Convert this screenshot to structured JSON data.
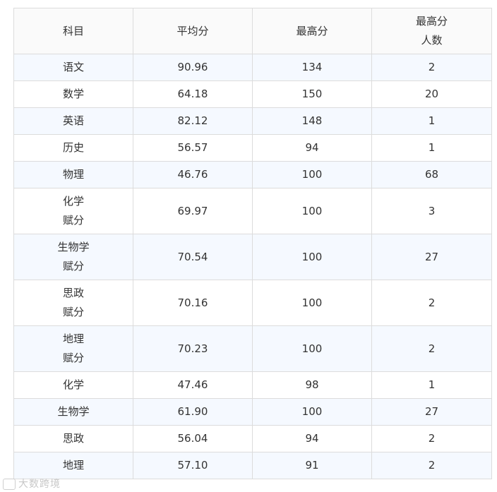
{
  "table": {
    "headers": [
      "科目",
      "平均分",
      "最高分",
      [
        "最高分",
        "人数"
      ]
    ],
    "rows": [
      {
        "subject": [
          "语文"
        ],
        "avg": "90.96",
        "max": "134",
        "count": "2"
      },
      {
        "subject": [
          "数学"
        ],
        "avg": "64.18",
        "max": "150",
        "count": "20"
      },
      {
        "subject": [
          "英语"
        ],
        "avg": "82.12",
        "max": "148",
        "count": "1"
      },
      {
        "subject": [
          "历史"
        ],
        "avg": "56.57",
        "max": "94",
        "count": "1"
      },
      {
        "subject": [
          "物理"
        ],
        "avg": "46.76",
        "max": "100",
        "count": "68"
      },
      {
        "subject": [
          "化学",
          "赋分"
        ],
        "avg": "69.97",
        "max": "100",
        "count": "3"
      },
      {
        "subject": [
          "生物学",
          "赋分"
        ],
        "avg": "70.54",
        "max": "100",
        "count": "27"
      },
      {
        "subject": [
          "思政",
          "赋分"
        ],
        "avg": "70.16",
        "max": "100",
        "count": "2"
      },
      {
        "subject": [
          "地理",
          "赋分"
        ],
        "avg": "70.23",
        "max": "100",
        "count": "2"
      },
      {
        "subject": [
          "化学"
        ],
        "avg": "47.46",
        "max": "98",
        "count": "1"
      },
      {
        "subject": [
          "生物学"
        ],
        "avg": "61.90",
        "max": "100",
        "count": "27"
      },
      {
        "subject": [
          "思政"
        ],
        "avg": "56.04",
        "max": "94",
        "count": "2"
      },
      {
        "subject": [
          "地理"
        ],
        "avg": "57.10",
        "max": "91",
        "count": "2"
      }
    ]
  },
  "watermark": {
    "text": "大数跨境"
  },
  "colors": {
    "border": "#dcdcdc",
    "header_bg": "#fafafa",
    "alt_row_bg": "#f5f9ff"
  }
}
